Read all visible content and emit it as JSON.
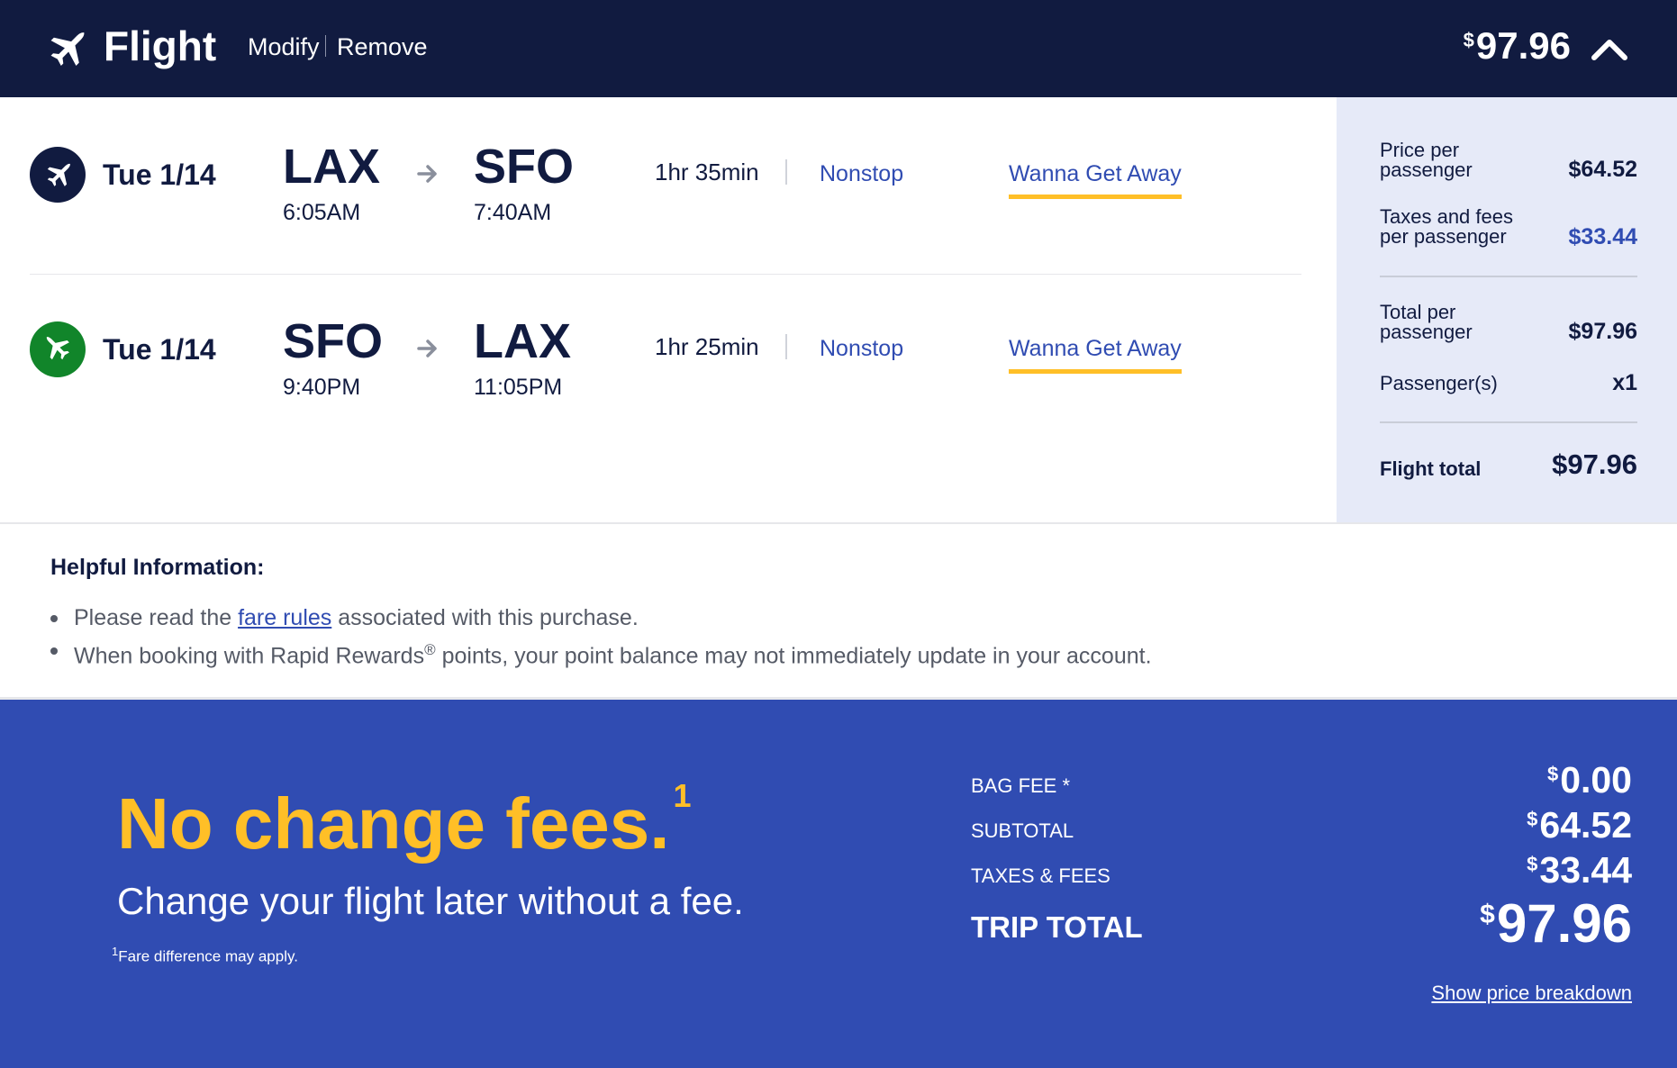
{
  "header": {
    "title": "Flight",
    "modify_label": "Modify",
    "remove_label": "Remove",
    "currency_symbol": "$",
    "total": "97.96"
  },
  "flights": [
    {
      "date": "Tue 1/14",
      "from_code": "LAX",
      "from_time": "6:05AM",
      "to_code": "SFO",
      "to_time": "7:40AM",
      "duration": "1hr 35min",
      "stops": "Nonstop",
      "fare": "Wanna Get Away",
      "badge_color": "#111b40"
    },
    {
      "date": "Tue 1/14",
      "from_code": "SFO",
      "from_time": "9:40PM",
      "to_code": "LAX",
      "to_time": "11:05PM",
      "duration": "1hr 25min",
      "stops": "Nonstop",
      "fare": "Wanna Get Away",
      "badge_color": "#11852a"
    }
  ],
  "price_panel": {
    "price_per_passenger_label": "Price per passenger",
    "price_per_passenger": "$64.52",
    "taxes_label": "Taxes and fees per passenger",
    "taxes": "$33.44",
    "total_per_passenger_label": "Total per passenger",
    "total_per_passenger": "$97.96",
    "passengers_label": "Passenger(s)",
    "passengers": "x1",
    "flight_total_label": "Flight total",
    "flight_total": "$97.96"
  },
  "helpful_info": {
    "title": "Helpful Information:",
    "item1_before": "Please read the",
    "item1_link": "fare rules",
    "item1_after": "associated with this purchase.",
    "item2_before": "When booking with Rapid Rewards",
    "item2_reg": "®",
    "item2_after": "points, your point balance may not immediately update in your account."
  },
  "promo": {
    "headline": "No change fees.",
    "headline_footnote_mark": "1",
    "subhead": "Change your flight later without a fee.",
    "footnote_mark": "1",
    "footnote": "Fare difference may apply."
  },
  "totals": {
    "currency_symbol": "$",
    "bag_fee_label": "BAG FEE *",
    "bag_fee": "0.00",
    "subtotal_label": "SUBTOTAL",
    "subtotal": "64.52",
    "taxes_label": "TAXES & FEES",
    "taxes": "33.44",
    "trip_total_label": "TRIP TOTAL",
    "trip_total": "97.96",
    "breakdown_link": "Show price breakdown"
  },
  "colors": {
    "navy": "#111b40",
    "blue": "#304cb2",
    "yellow": "#ffbf27",
    "green": "#11852a",
    "panel_bg": "#e6eaf8"
  },
  "icons": [
    "plane-icon",
    "chevron-up-icon",
    "arrow-right-icon"
  ]
}
